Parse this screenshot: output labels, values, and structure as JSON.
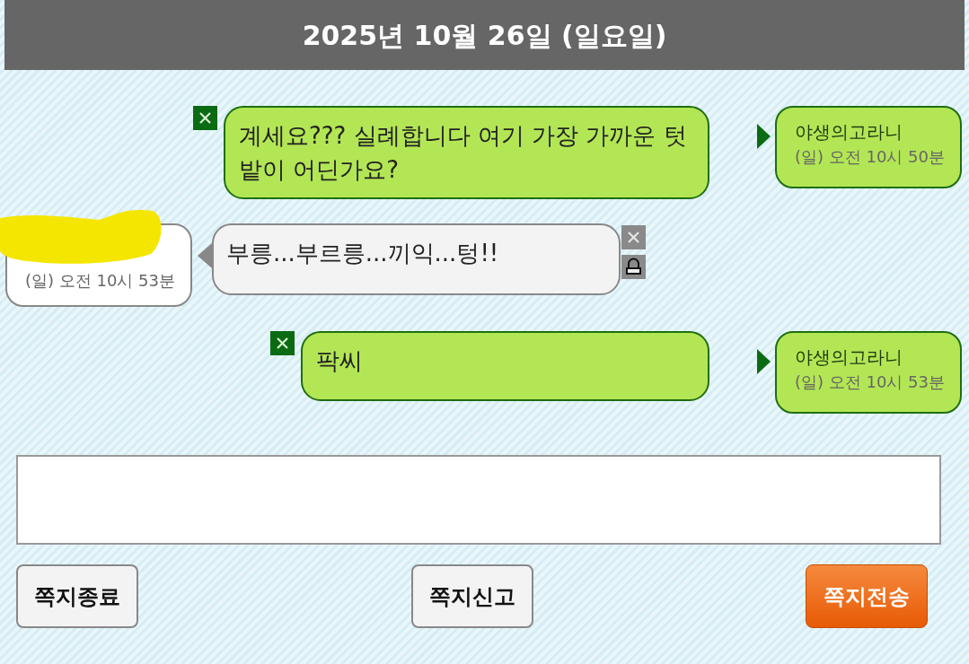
{
  "header": {
    "title": "2025년 10월 26일 (일요일)"
  },
  "messages": [
    {
      "kind": "sent",
      "text": "계세요??? 실례합니다 여기 가장 가까운 텃밭이 어딘가요?",
      "sender": "야생의고라니",
      "time": "(일) 오전 10시 50분"
    },
    {
      "kind": "received",
      "text": "부릉...부르릉...끼익...텅!!",
      "time": "(일) 오전 10시 53분"
    },
    {
      "kind": "sent",
      "text": "팍씨",
      "sender": "야생의고라니",
      "time": "(일) 오전 10시 53분"
    }
  ],
  "buttons": [
    {
      "label": "쪽지종료",
      "kind": "plain"
    },
    {
      "label": "쪽지신고",
      "kind": "plain"
    },
    {
      "label": "쪽지전송",
      "kind": "primary"
    }
  ]
}
